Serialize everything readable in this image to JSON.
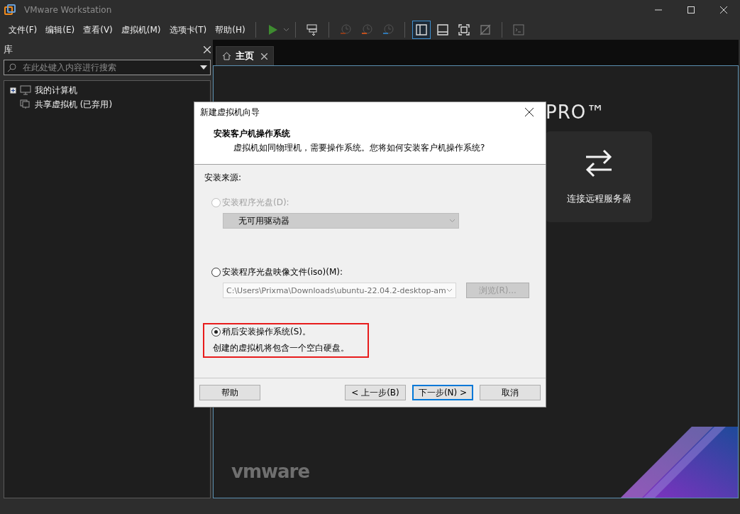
{
  "window": {
    "title": "VMware Workstation"
  },
  "menu": [
    {
      "label": "文件(F)"
    },
    {
      "label": "编辑(E)"
    },
    {
      "label": "查看(V)"
    },
    {
      "label": "虚拟机(M)"
    },
    {
      "label": "选项卡(T)"
    },
    {
      "label": "帮助(H)"
    }
  ],
  "view_modes": [
    {
      "selected": true
    },
    {
      "selected": false
    },
    {
      "selected": false
    },
    {
      "selected": false
    }
  ],
  "library": {
    "title": "库",
    "search": {
      "placeholder": "在此处键入内容进行搜索"
    },
    "items": [
      {
        "label": "我的计算机",
        "kind": "computer"
      },
      {
        "label": "共享虚拟机 (已弃用)",
        "kind": "shared"
      }
    ]
  },
  "tabs": [
    {
      "label": "主页",
      "selected": true
    }
  ],
  "home": {
    "edition": "PRO™",
    "actions": [
      {
        "label": "连接远程服务器"
      }
    ],
    "brand": "vmware"
  },
  "dialog": {
    "title": "新建虚拟机向导",
    "heading": "安装客户机操作系统",
    "subheading": "虚拟机如同物理机，需要操作系统。您将如何安装客户机操作系统?",
    "source_label": "安装来源:",
    "options": [
      {
        "label": "安装程序光盘(D):",
        "selected": false,
        "disabled": true,
        "highlighted": false,
        "combo": {
          "kind": "dropdown",
          "value": "无可用驱动器"
        }
      },
      {
        "label": "安装程序光盘映像文件(iso)(M):",
        "selected": false,
        "disabled": false,
        "highlighted": false,
        "combo": {
          "kind": "editable",
          "value": "C:\\Users\\Prixma\\Downloads\\ubuntu-22.04.2-desktop-am"
        },
        "browse": {
          "label": "浏览(R)...",
          "disabled": true
        }
      },
      {
        "label": "稍后安装操作系统(S)。",
        "selected": true,
        "disabled": false,
        "highlighted": true,
        "description": "创建的虚拟机将包含一个空白硬盘。"
      }
    ],
    "buttons": [
      {
        "label": "帮助",
        "focused": false
      },
      {
        "label": "< 上一步(B)",
        "focused": false
      },
      {
        "label": "下一步(N) >",
        "focused": true
      },
      {
        "label": "取消",
        "focused": false
      }
    ]
  }
}
